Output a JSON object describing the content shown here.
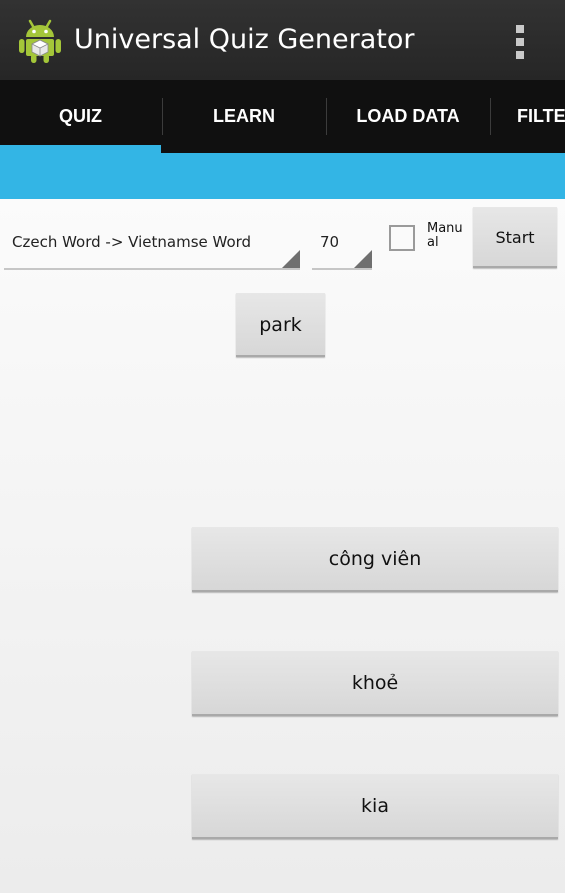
{
  "app": {
    "title": "Universal Quiz Generator",
    "icon": "android-robot-icon",
    "overflow_icon": "overflow-menu-icon"
  },
  "tabs": [
    {
      "label": "QUIZ",
      "selected": true
    },
    {
      "label": "LEARN",
      "selected": false
    },
    {
      "label": "LOAD DATA",
      "selected": false
    },
    {
      "label": "FILTE",
      "selected": false
    }
  ],
  "quiz": {
    "mode_selected": "Czech Word -> Vietnamse Word",
    "count_selected": "70",
    "manual_label": "Manual",
    "manual_checked": false,
    "start_label": "Start",
    "question_word": "park",
    "answers": [
      "công viên",
      "khoẻ",
      "kia"
    ]
  },
  "colors": {
    "accent": "#33b5e5",
    "action_bar": "#2b2b2b",
    "tab_bar": "#101010",
    "button": "#dedede"
  }
}
